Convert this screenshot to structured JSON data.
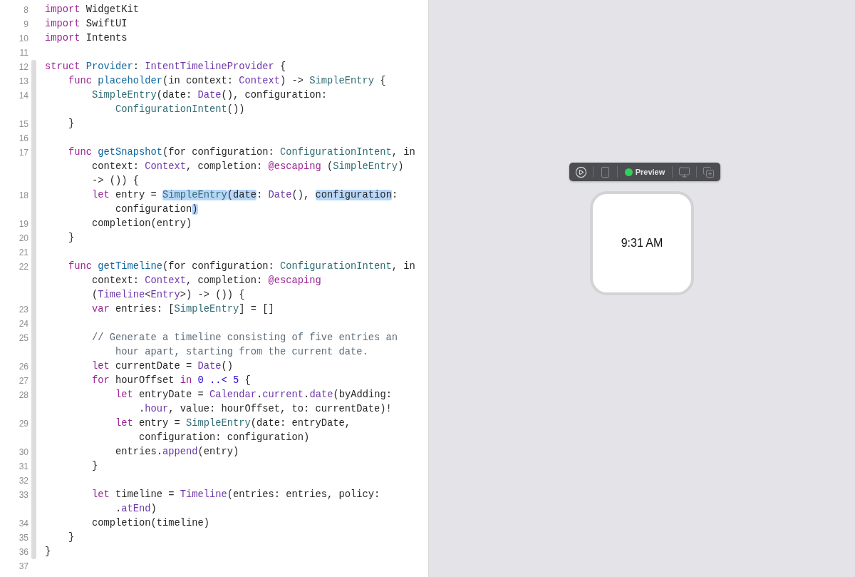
{
  "editor": {
    "lines": [
      {
        "number": "8",
        "rows": [
          {
            "spans": [
              {
                "text": "import",
                "kind": "keyword"
              },
              {
                "text": " WidgetKit",
                "kind": "plain"
              }
            ]
          }
        ]
      },
      {
        "number": "9",
        "rows": [
          {
            "spans": [
              {
                "text": "import",
                "kind": "keyword"
              },
              {
                "text": " SwiftUI",
                "kind": "plain"
              }
            ]
          }
        ]
      },
      {
        "number": "10",
        "rows": [
          {
            "spans": [
              {
                "text": "import",
                "kind": "keyword"
              },
              {
                "text": " Intents",
                "kind": "plain"
              }
            ]
          }
        ]
      },
      {
        "number": "11"
      },
      {
        "number": "12",
        "rows": [
          {
            "spans": [
              {
                "text": "struct ",
                "kind": "keyword"
              },
              {
                "text": "Provider",
                "kind": "declaration"
              },
              {
                "text": ": ",
                "kind": "plain"
              },
              {
                "text": "IntentTimelineProvider",
                "kind": "system"
              },
              {
                "text": " {",
                "kind": "plain"
              }
            ]
          }
        ]
      },
      {
        "number": "13",
        "rows": [
          {
            "spans": [
              {
                "text": "    func ",
                "kind": "keyword"
              },
              {
                "text": "placeholder",
                "kind": "declaration"
              },
              {
                "text": "(in context: ",
                "kind": "plain"
              },
              {
                "text": "Context",
                "kind": "system"
              },
              {
                "text": ") -> ",
                "kind": "plain"
              },
              {
                "text": "SimpleEntry",
                "kind": "project"
              },
              {
                "text": " {",
                "kind": "plain"
              }
            ]
          }
        ]
      },
      {
        "number": "14",
        "rows": [
          {
            "spans": [
              {
                "text": "        SimpleEntry",
                "kind": "project"
              },
              {
                "text": "(date: ",
                "kind": "plain"
              },
              {
                "text": "Date",
                "kind": "system"
              },
              {
                "text": "(), configuration:",
                "kind": "plain"
              }
            ]
          },
          {
            "spans": [
              {
                "text": "            ConfigurationIntent",
                "kind": "project"
              },
              {
                "text": "())",
                "kind": "plain"
              }
            ]
          }
        ]
      },
      {
        "number": "15",
        "rows": [
          {
            "spans": [
              {
                "text": "    }",
                "kind": "plain"
              }
            ]
          }
        ]
      },
      {
        "number": "16"
      },
      {
        "number": "17",
        "rows": [
          {
            "spans": [
              {
                "text": "    func ",
                "kind": "keyword"
              },
              {
                "text": "getSnapshot",
                "kind": "declaration"
              },
              {
                "text": "(for configuration: ",
                "kind": "plain"
              },
              {
                "text": "ConfigurationIntent",
                "kind": "project"
              },
              {
                "text": ", in",
                "kind": "plain"
              }
            ]
          },
          {
            "spans": [
              {
                "text": "        context: ",
                "kind": "plain"
              },
              {
                "text": "Context",
                "kind": "system"
              },
              {
                "text": ", completion: ",
                "kind": "plain"
              },
              {
                "text": "@escaping",
                "kind": "keyword"
              },
              {
                "text": " (",
                "kind": "plain"
              },
              {
                "text": "SimpleEntry",
                "kind": "project"
              },
              {
                "text": ")",
                "kind": "plain"
              }
            ]
          },
          {
            "spans": [
              {
                "text": "        -> ()) {",
                "kind": "plain"
              }
            ]
          }
        ]
      },
      {
        "number": "18",
        "rows": [
          {
            "spans": [
              {
                "text": "        let",
                "kind": "keyword"
              },
              {
                "text": " entry = ",
                "kind": "plain"
              },
              {
                "text": "SimpleEntry",
                "kind": "project",
                "highlighted": true
              },
              {
                "text": "(date",
                "kind": "plain",
                "highlighted": true
              },
              {
                "text": ": ",
                "kind": "plain"
              },
              {
                "text": "Date",
                "kind": "system"
              },
              {
                "text": "(), ",
                "kind": "plain"
              },
              {
                "text": "configuration",
                "kind": "plain",
                "highlighted": true
              },
              {
                "text": ":",
                "kind": "plain"
              }
            ]
          },
          {
            "spans": [
              {
                "text": "            configuration",
                "kind": "plain"
              },
              {
                "text": ")",
                "kind": "plain",
                "highlighted": true
              }
            ]
          }
        ]
      },
      {
        "number": "19",
        "rows": [
          {
            "spans": [
              {
                "text": "        completion(entry)",
                "kind": "plain"
              }
            ]
          }
        ]
      },
      {
        "number": "20",
        "rows": [
          {
            "spans": [
              {
                "text": "    }",
                "kind": "plain"
              }
            ]
          }
        ]
      },
      {
        "number": "21"
      },
      {
        "number": "22",
        "rows": [
          {
            "spans": [
              {
                "text": "    func ",
                "kind": "keyword"
              },
              {
                "text": "getTimeline",
                "kind": "declaration"
              },
              {
                "text": "(for configuration: ",
                "kind": "plain"
              },
              {
                "text": "ConfigurationIntent",
                "kind": "project"
              },
              {
                "text": ", in",
                "kind": "plain"
              }
            ]
          },
          {
            "spans": [
              {
                "text": "        context: ",
                "kind": "plain"
              },
              {
                "text": "Context",
                "kind": "system"
              },
              {
                "text": ", completion: ",
                "kind": "plain"
              },
              {
                "text": "@escaping",
                "kind": "keyword"
              }
            ]
          },
          {
            "spans": [
              {
                "text": "        (",
                "kind": "plain"
              },
              {
                "text": "Timeline",
                "kind": "system"
              },
              {
                "text": "<",
                "kind": "plain"
              },
              {
                "text": "Entry",
                "kind": "system"
              },
              {
                "text": ">) -> ()) {",
                "kind": "plain"
              }
            ]
          }
        ]
      },
      {
        "number": "23",
        "rows": [
          {
            "spans": [
              {
                "text": "        var",
                "kind": "keyword"
              },
              {
                "text": " entries: [",
                "kind": "plain"
              },
              {
                "text": "SimpleEntry",
                "kind": "project"
              },
              {
                "text": "] = []",
                "kind": "plain"
              }
            ]
          }
        ]
      },
      {
        "number": "24"
      },
      {
        "number": "25",
        "rows": [
          {
            "spans": [
              {
                "text": "        // Generate a timeline consisting of five entries an",
                "kind": "comment"
              }
            ]
          },
          {
            "spans": [
              {
                "text": "            hour apart, starting from the current date.",
                "kind": "comment"
              }
            ]
          }
        ]
      },
      {
        "number": "26",
        "rows": [
          {
            "spans": [
              {
                "text": "        let",
                "kind": "keyword"
              },
              {
                "text": " currentDate = ",
                "kind": "plain"
              },
              {
                "text": "Date",
                "kind": "system"
              },
              {
                "text": "()",
                "kind": "plain"
              }
            ]
          }
        ]
      },
      {
        "number": "27",
        "rows": [
          {
            "spans": [
              {
                "text": "        for",
                "kind": "keyword"
              },
              {
                "text": " hourOffset ",
                "kind": "plain"
              },
              {
                "text": "in ",
                "kind": "keyword"
              },
              {
                "text": "0 ..< 5",
                "kind": "number"
              },
              {
                "text": " {",
                "kind": "plain"
              }
            ]
          }
        ]
      },
      {
        "number": "28",
        "rows": [
          {
            "spans": [
              {
                "text": "            let",
                "kind": "keyword"
              },
              {
                "text": " entryDate = ",
                "kind": "plain"
              },
              {
                "text": "Calendar",
                "kind": "system"
              },
              {
                "text": ".",
                "kind": "plain"
              },
              {
                "text": "current",
                "kind": "system"
              },
              {
                "text": ".",
                "kind": "plain"
              },
              {
                "text": "date",
                "kind": "system"
              },
              {
                "text": "(byAdding:",
                "kind": "plain"
              }
            ]
          },
          {
            "spans": [
              {
                "text": "                .",
                "kind": "plain"
              },
              {
                "text": "hour",
                "kind": "system"
              },
              {
                "text": ", value: hourOffset, to: currentDate)!",
                "kind": "plain"
              }
            ]
          }
        ]
      },
      {
        "number": "29",
        "rows": [
          {
            "spans": [
              {
                "text": "            let",
                "kind": "keyword"
              },
              {
                "text": " entry = ",
                "kind": "plain"
              },
              {
                "text": "SimpleEntry",
                "kind": "project"
              },
              {
                "text": "(date: entryDate,",
                "kind": "plain"
              }
            ]
          },
          {
            "spans": [
              {
                "text": "                configuration: configuration)",
                "kind": "plain"
              }
            ]
          }
        ]
      },
      {
        "number": "30",
        "rows": [
          {
            "spans": [
              {
                "text": "            entries.",
                "kind": "plain"
              },
              {
                "text": "append",
                "kind": "system"
              },
              {
                "text": "(entry)",
                "kind": "plain"
              }
            ]
          }
        ]
      },
      {
        "number": "31",
        "rows": [
          {
            "spans": [
              {
                "text": "        }",
                "kind": "plain"
              }
            ]
          }
        ]
      },
      {
        "number": "32"
      },
      {
        "number": "33",
        "rows": [
          {
            "spans": [
              {
                "text": "        let",
                "kind": "keyword"
              },
              {
                "text": " timeline = ",
                "kind": "plain"
              },
              {
                "text": "Timeline",
                "kind": "system"
              },
              {
                "text": "(entries: entries, policy:",
                "kind": "plain"
              }
            ]
          },
          {
            "spans": [
              {
                "text": "            .",
                "kind": "plain"
              },
              {
                "text": "atEnd",
                "kind": "system"
              },
              {
                "text": ")",
                "kind": "plain"
              }
            ]
          }
        ]
      },
      {
        "number": "34",
        "rows": [
          {
            "spans": [
              {
                "text": "        completion(timeline)",
                "kind": "plain"
              }
            ]
          }
        ]
      },
      {
        "number": "35",
        "rows": [
          {
            "spans": [
              {
                "text": "    }",
                "kind": "plain"
              }
            ]
          }
        ]
      },
      {
        "number": "36",
        "rows": [
          {
            "spans": [
              {
                "text": "}",
                "kind": "plain"
              }
            ]
          }
        ]
      },
      {
        "number": "37"
      }
    ]
  },
  "preview": {
    "toolbar": {
      "label": "Preview"
    },
    "widget": {
      "time": "9:31 AM"
    }
  }
}
